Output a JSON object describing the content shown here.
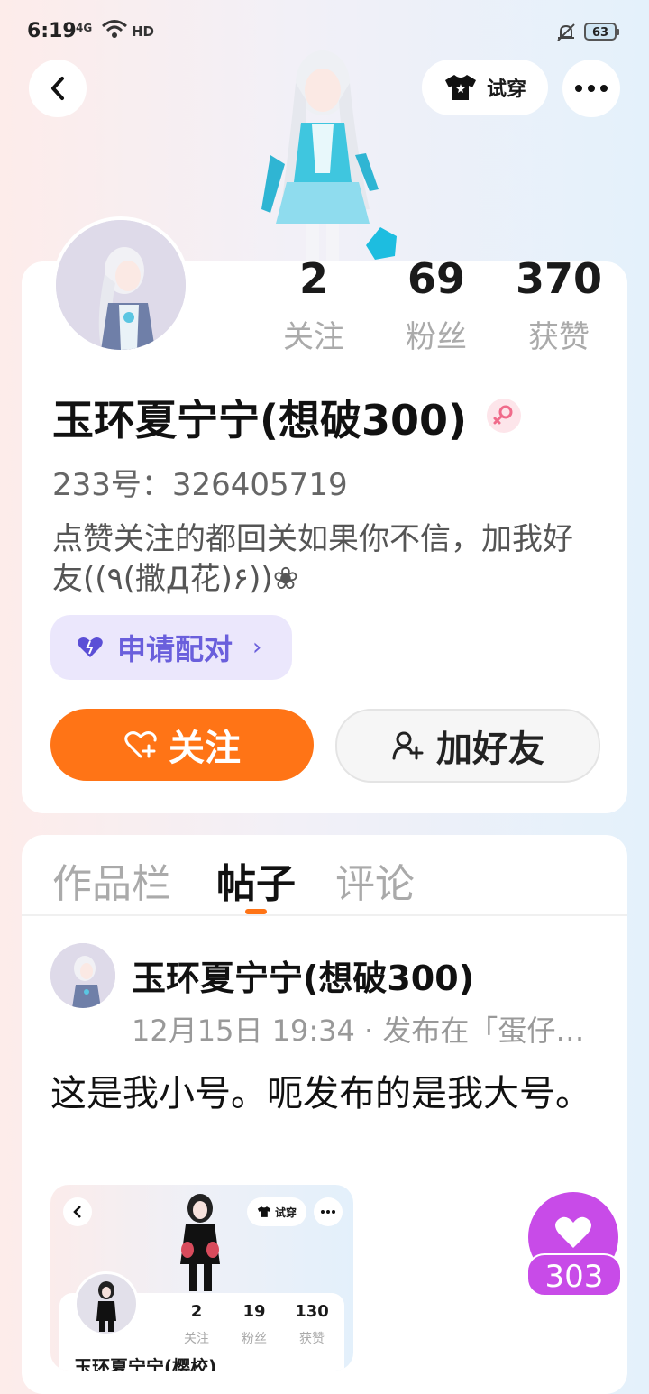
{
  "status_bar": {
    "time": "6:19",
    "signal": "4G",
    "hd": "HD",
    "battery": "63"
  },
  "header": {
    "try_on_label": "试穿"
  },
  "stats": [
    {
      "value": "2",
      "label": "关注"
    },
    {
      "value": "69",
      "label": "粉丝"
    },
    {
      "value": "370",
      "label": "获赞"
    }
  ],
  "profile": {
    "name": "玉环夏宁宁(想破300)",
    "gender_symbol": "♀",
    "uid": "233号：326405719",
    "bio": "点赞关注的都回关如果你不信，加我好友((٩(撒Д花)۶))❀",
    "pair_label": "申请配对",
    "follow_label": "关注",
    "add_friend_label": "加好友"
  },
  "tabs": [
    {
      "label": "作品栏",
      "active": false
    },
    {
      "label": "帖子",
      "active": true
    },
    {
      "label": "评论",
      "active": false
    }
  ],
  "post": {
    "author": "玉环夏宁宁(想破300)",
    "meta": "12月15日 19:34 · 发布在「蛋仔…",
    "text": "这是我小号。呃发布的是我大号。",
    "thumb": {
      "try_on_label": "试穿",
      "stats": [
        {
          "value": "2",
          "label": "关注"
        },
        {
          "value": "19",
          "label": "粉丝"
        },
        {
          "value": "130",
          "label": "获赞"
        }
      ],
      "name": "玉环夏宁宁(樱校)"
    }
  },
  "like_count": "303"
}
